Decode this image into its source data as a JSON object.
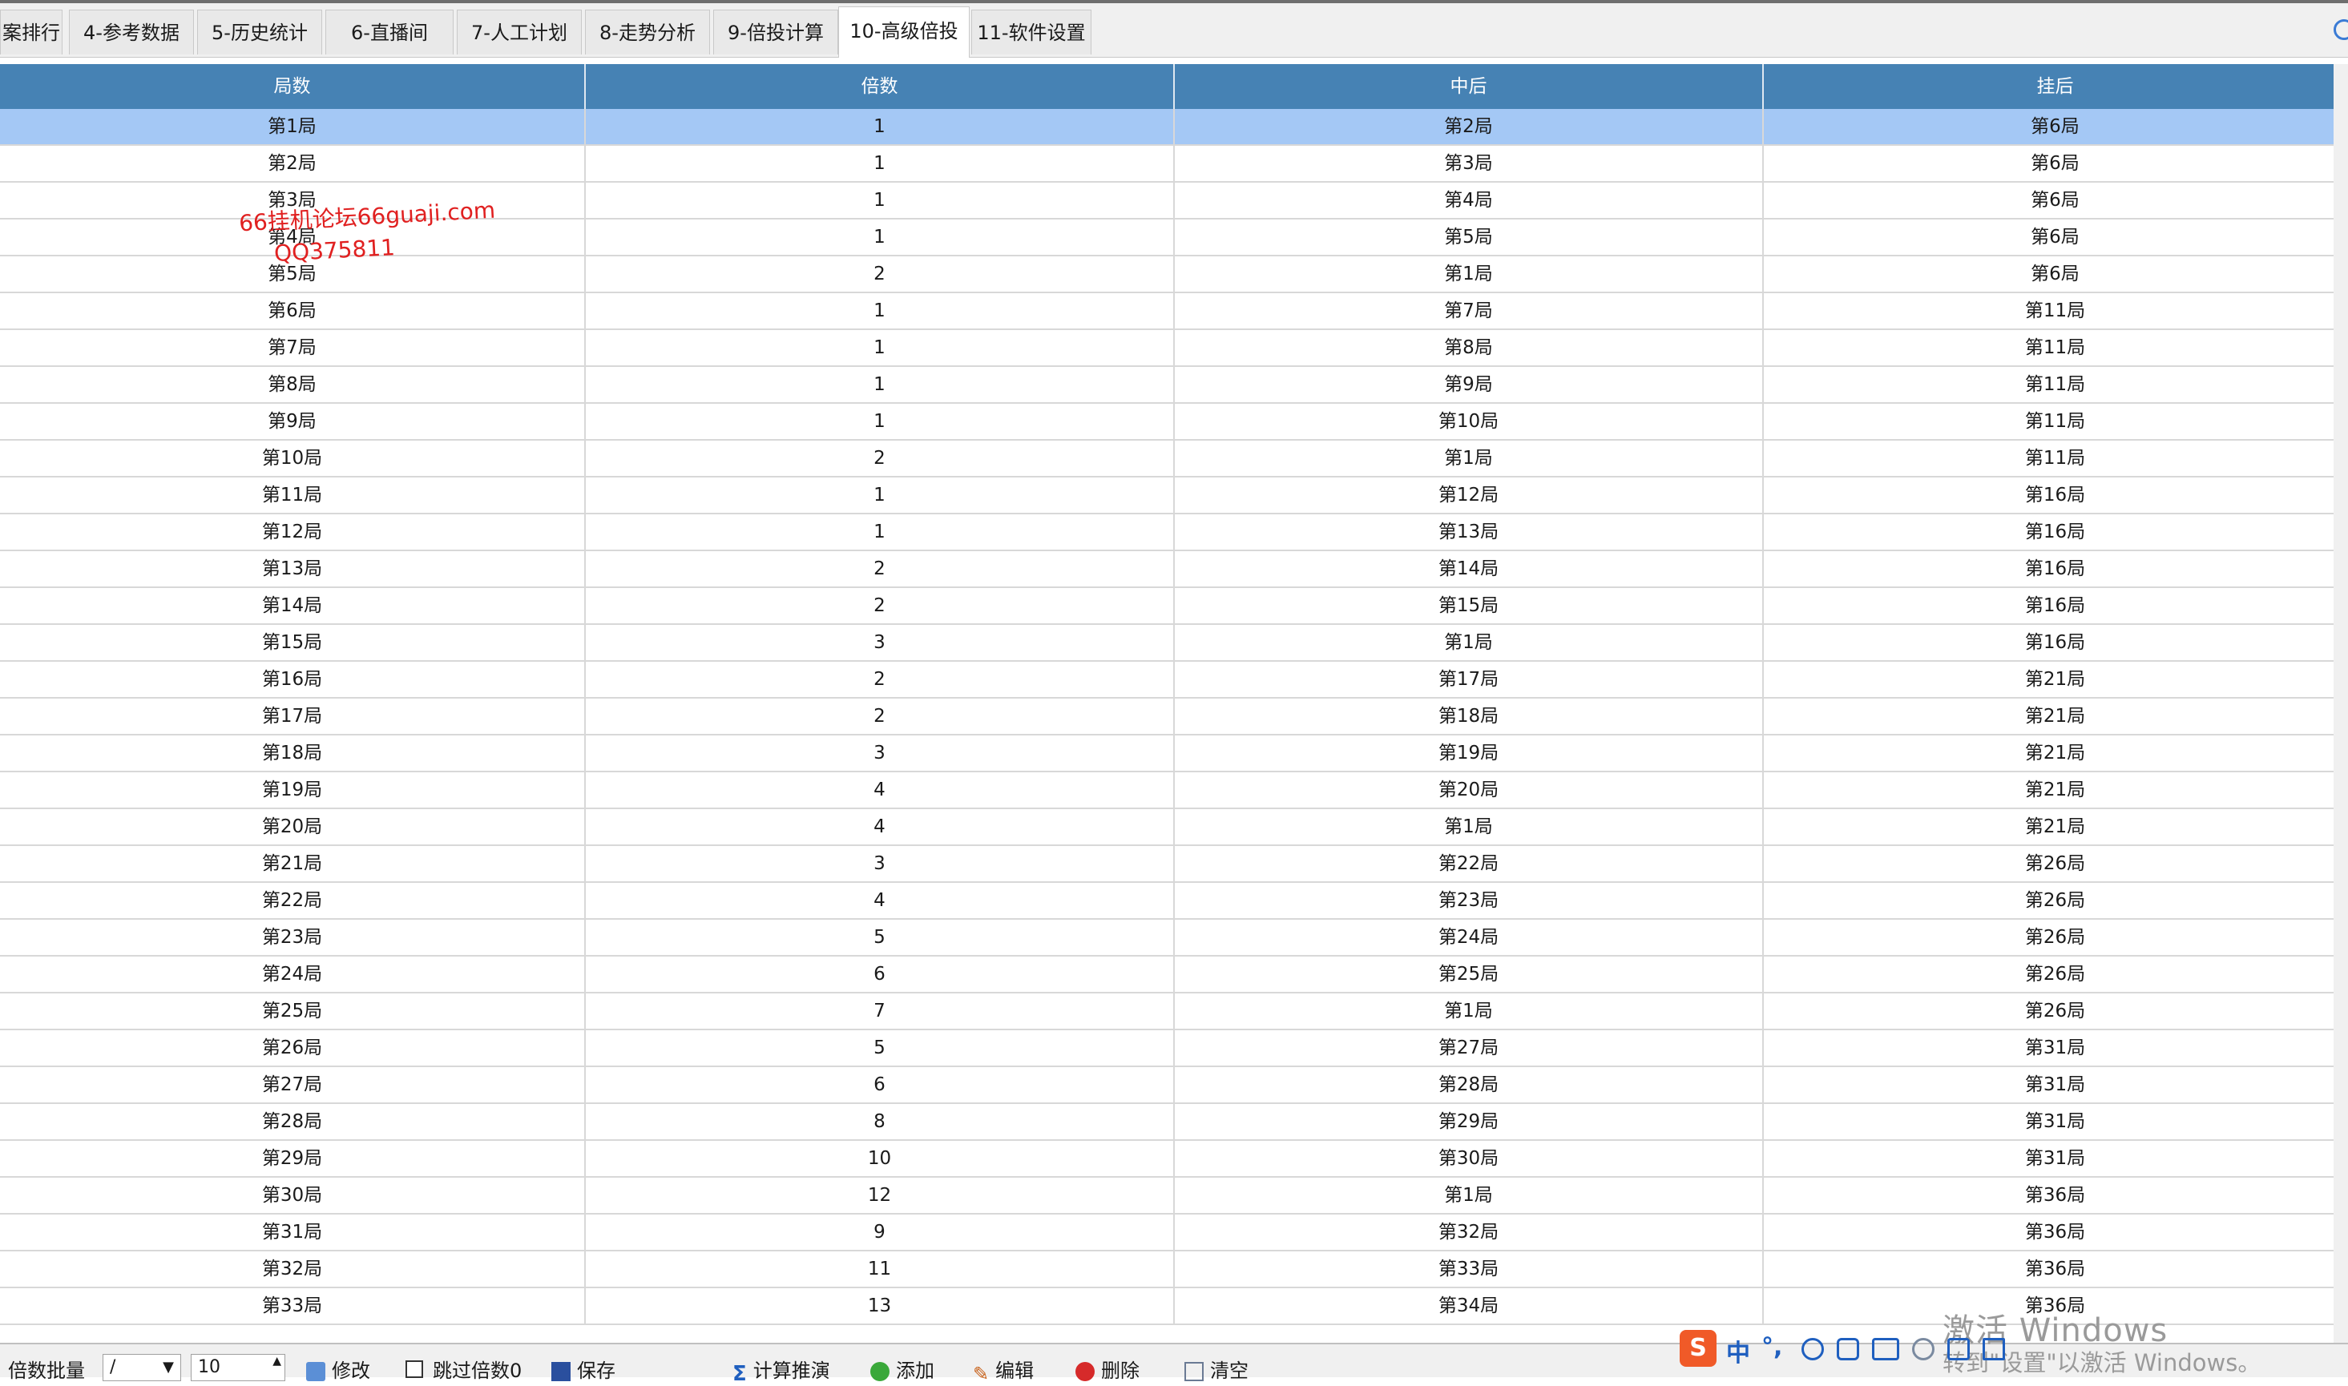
{
  "tabs": [
    {
      "label": "案排行",
      "active": false
    },
    {
      "label": "4-参考数据",
      "active": false
    },
    {
      "label": "5-历史统计",
      "active": false
    },
    {
      "label": "6-直播间",
      "active": false
    },
    {
      "label": "7-人工计划",
      "active": false
    },
    {
      "label": "8-走势分析",
      "active": false
    },
    {
      "label": "9-倍投计算",
      "active": false
    },
    {
      "label": "10-高级倍投",
      "active": true
    },
    {
      "label": "11-软件设置",
      "active": false
    }
  ],
  "table": {
    "columns": [
      "局数",
      "倍数",
      "中后",
      "挂后"
    ],
    "rows": [
      [
        "第1局",
        "1",
        "第2局",
        "第6局"
      ],
      [
        "第2局",
        "1",
        "第3局",
        "第6局"
      ],
      [
        "第3局",
        "1",
        "第4局",
        "第6局"
      ],
      [
        "第4局",
        "1",
        "第5局",
        "第6局"
      ],
      [
        "第5局",
        "2",
        "第1局",
        "第6局"
      ],
      [
        "第6局",
        "1",
        "第7局",
        "第11局"
      ],
      [
        "第7局",
        "1",
        "第8局",
        "第11局"
      ],
      [
        "第8局",
        "1",
        "第9局",
        "第11局"
      ],
      [
        "第9局",
        "1",
        "第10局",
        "第11局"
      ],
      [
        "第10局",
        "2",
        "第1局",
        "第11局"
      ],
      [
        "第11局",
        "1",
        "第12局",
        "第16局"
      ],
      [
        "第12局",
        "1",
        "第13局",
        "第16局"
      ],
      [
        "第13局",
        "2",
        "第14局",
        "第16局"
      ],
      [
        "第14局",
        "2",
        "第15局",
        "第16局"
      ],
      [
        "第15局",
        "3",
        "第1局",
        "第16局"
      ],
      [
        "第16局",
        "2",
        "第17局",
        "第21局"
      ],
      [
        "第17局",
        "2",
        "第18局",
        "第21局"
      ],
      [
        "第18局",
        "3",
        "第19局",
        "第21局"
      ],
      [
        "第19局",
        "4",
        "第20局",
        "第21局"
      ],
      [
        "第20局",
        "4",
        "第1局",
        "第21局"
      ],
      [
        "第21局",
        "3",
        "第22局",
        "第26局"
      ],
      [
        "第22局",
        "4",
        "第23局",
        "第26局"
      ],
      [
        "第23局",
        "5",
        "第24局",
        "第26局"
      ],
      [
        "第24局",
        "6",
        "第25局",
        "第26局"
      ],
      [
        "第25局",
        "7",
        "第1局",
        "第26局"
      ],
      [
        "第26局",
        "5",
        "第27局",
        "第31局"
      ],
      [
        "第27局",
        "6",
        "第28局",
        "第31局"
      ],
      [
        "第28局",
        "8",
        "第29局",
        "第31局"
      ],
      [
        "第29局",
        "10",
        "第30局",
        "第31局"
      ],
      [
        "第30局",
        "12",
        "第1局",
        "第36局"
      ],
      [
        "第31局",
        "9",
        "第32局",
        "第36局"
      ],
      [
        "第32局",
        "11",
        "第33局",
        "第36局"
      ],
      [
        "第33局",
        "13",
        "第34局",
        "第36局"
      ]
    ],
    "selected_row": 0
  },
  "watermark": {
    "line1": "66挂机论坛66guaji.com",
    "line2": "QQ375811"
  },
  "toolbar": {
    "batch_label": "倍数批量",
    "operator_value": "/",
    "number_value": "10",
    "modify_label": "修改",
    "skip_label": "跳过倍数0",
    "save_label": "保存",
    "calc_label": "计算推演",
    "add_label": "添加",
    "edit_label": "编辑",
    "delete_label": "删除",
    "clear_label": "清空"
  },
  "ime": {
    "logo": "S",
    "mode": "中",
    "punct": "°,"
  },
  "activation": {
    "line1": "激活 Windows",
    "line2": "转到\"设置\"以激活 Windows。"
  },
  "colors": {
    "header_bg": "#4682b4",
    "selected_row": "#a4c8f5",
    "watermark": "#e02020"
  }
}
